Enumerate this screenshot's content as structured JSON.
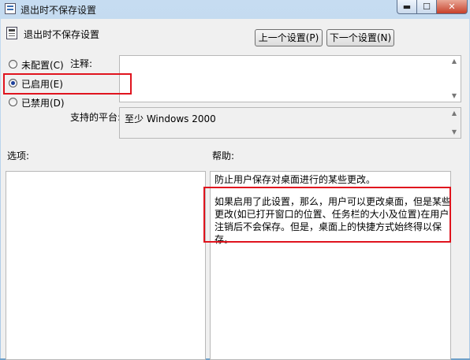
{
  "window": {
    "title": "退出时不保存设置",
    "minimize_glyph": "▬",
    "maximize_glyph": "☐",
    "close_glyph": "✕"
  },
  "header": {
    "title": "退出时不保存设置",
    "prev_button": "上一个设置(P)",
    "next_button": "下一个设置(N)"
  },
  "options": [
    {
      "label": "未配置(C)",
      "checked": false
    },
    {
      "label": "已启用(E)",
      "checked": true
    },
    {
      "label": "已禁用(D)",
      "checked": false
    }
  ],
  "comment": {
    "label": "注释:",
    "value": ""
  },
  "platform": {
    "label": "支持的平台:",
    "value": "至少 Windows 2000"
  },
  "options_section": {
    "label": "选项:"
  },
  "help": {
    "label": "帮助:",
    "paragraph1": "防止用户保存对桌面进行的某些更改。",
    "paragraph2": "如果启用了此设置，那么，用户可以更改桌面，但是某些更改(如已打开窗口的位置、任务栏的大小及位置)在用户注销后不会保存。但是，桌面上的快捷方式始终得以保存。"
  },
  "highlight_color": "#e0141e"
}
